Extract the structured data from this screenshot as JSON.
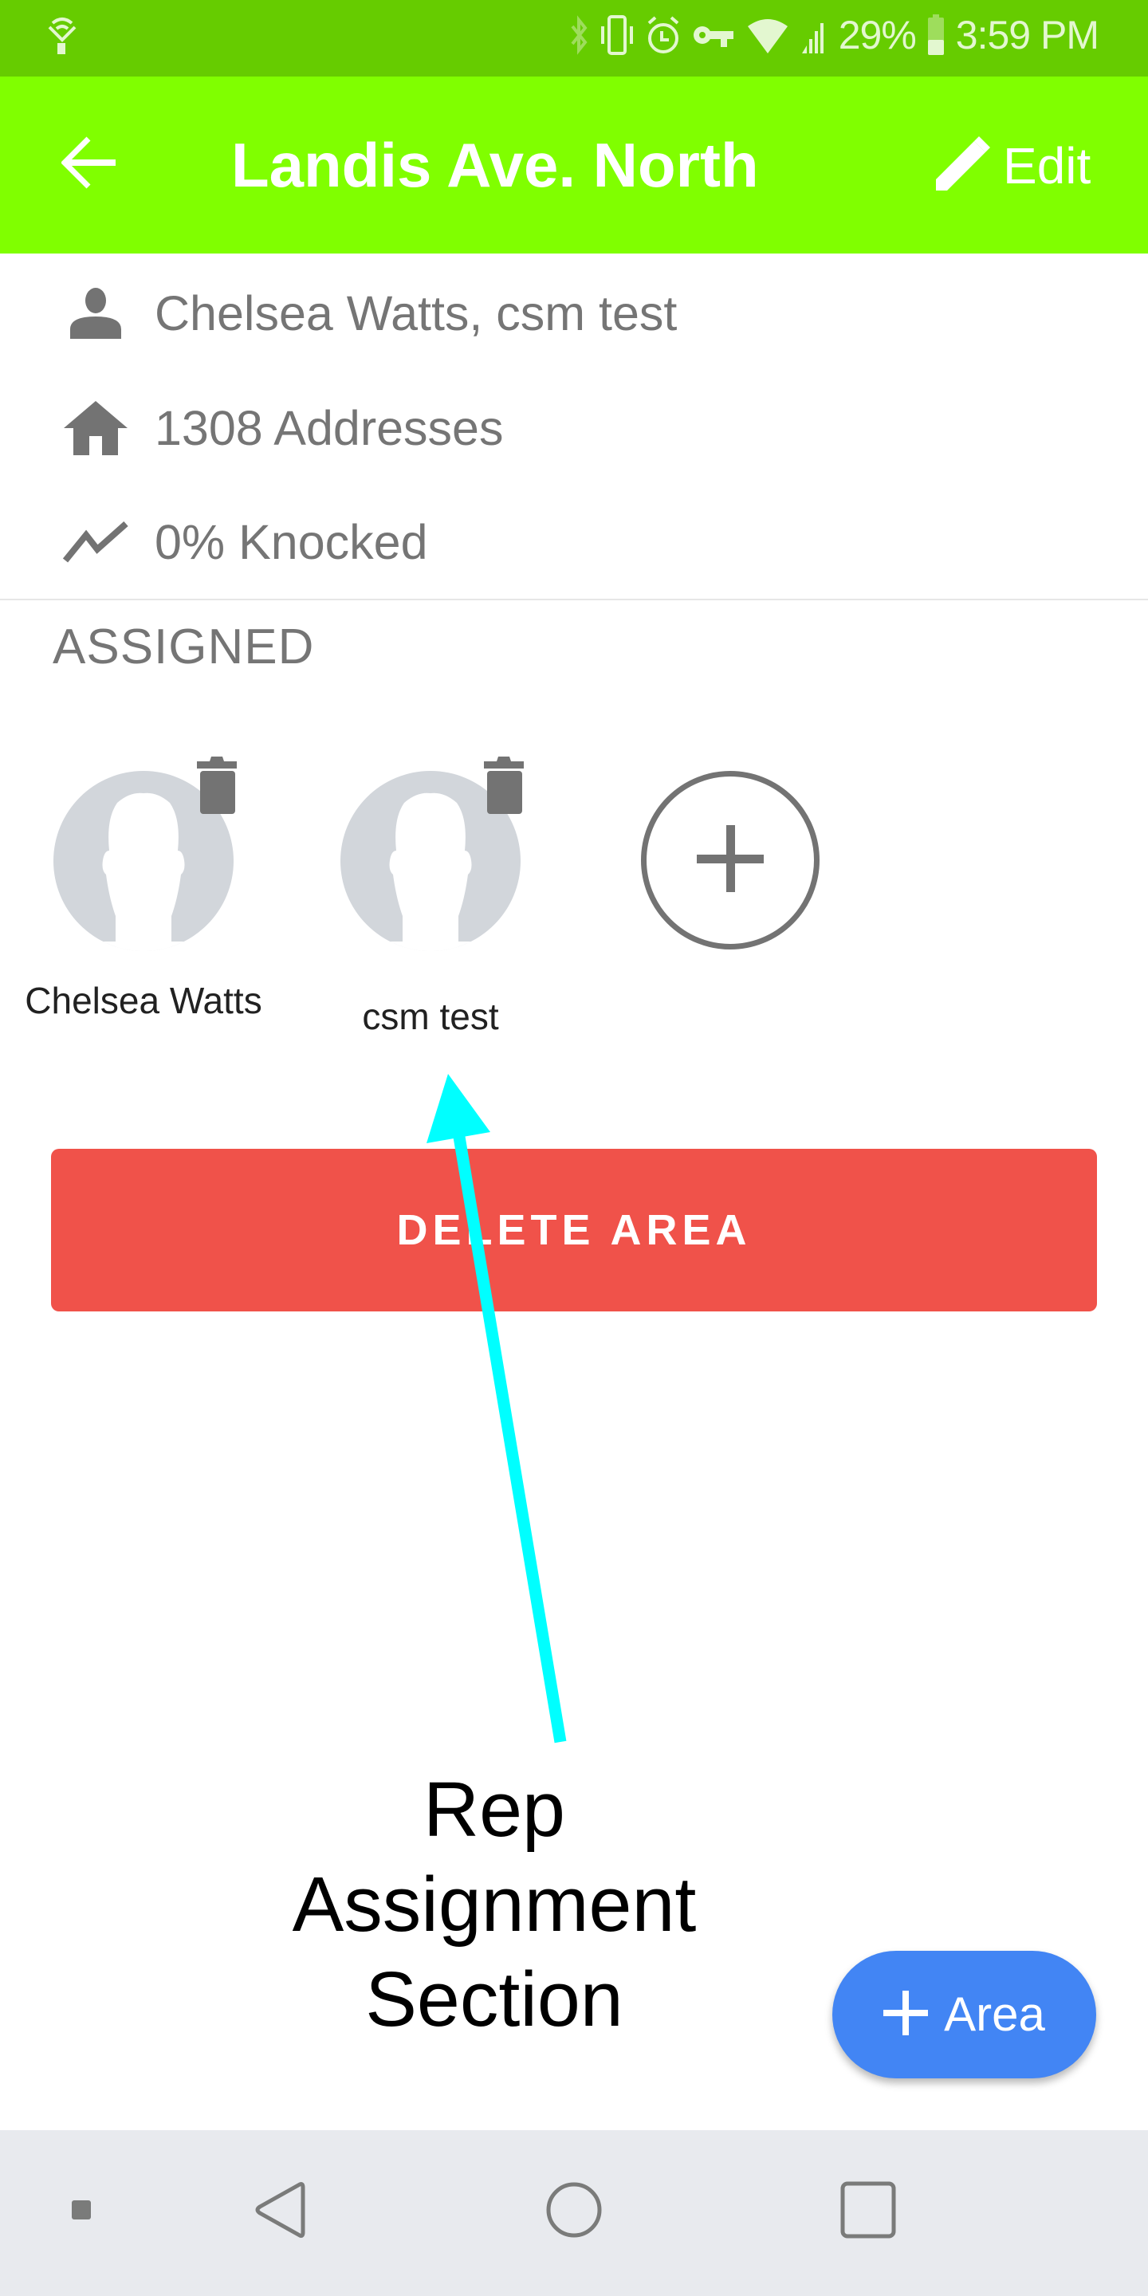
{
  "status_bar": {
    "battery_percent": "29%",
    "time": "3:59 PM",
    "icons": [
      "wifi-calling-icon",
      "bluetooth-icon",
      "vibrate-icon",
      "alarm-icon",
      "vpn-key-icon",
      "wifi-icon",
      "cell-signal-icon",
      "battery-icon"
    ],
    "background_color": "#66CC00"
  },
  "app_bar": {
    "title": "Landis Ave. North",
    "edit_label": "Edit",
    "back_icon": "arrow-back-icon",
    "edit_icon": "pencil-icon",
    "background_color": "#80FF00"
  },
  "info": {
    "assigned_reps": "Chelsea Watts, csm test",
    "addresses": "1308 Addresses",
    "knocked": "0% Knocked"
  },
  "assigned": {
    "label": "ASSIGNED",
    "reps": [
      {
        "name": "Chelsea Watts"
      },
      {
        "name": "csm test"
      }
    ],
    "add_icon": "plus-circle-icon"
  },
  "delete_button": {
    "label": "DELETE AREA",
    "color": "#F0524A"
  },
  "annotation": {
    "lines": [
      "Rep",
      "Assignment",
      "Section"
    ],
    "arrow_color": "#00FFFF"
  },
  "fab": {
    "label": "Area",
    "icon": "plus-icon",
    "color": "#4285F4"
  },
  "nav_bar": {
    "items": [
      "square-dot-icon",
      "back-triangle-icon",
      "home-circle-icon",
      "recents-square-icon"
    ]
  }
}
